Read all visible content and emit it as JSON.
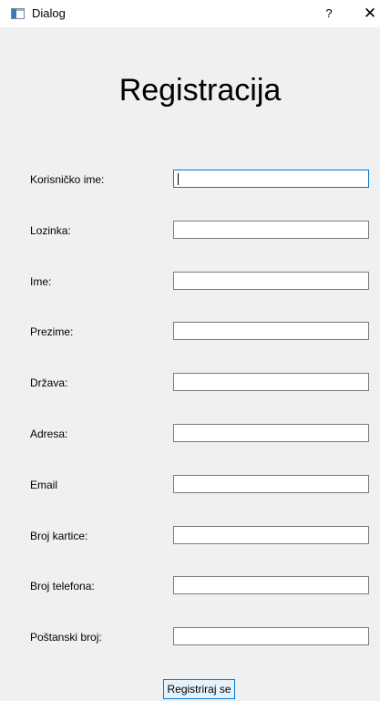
{
  "window": {
    "title": "Dialog",
    "help_glyph": "?",
    "close_glyph": "✕"
  },
  "form": {
    "heading": "Registracija",
    "fields": [
      {
        "label": "Korisničko ime:",
        "value": ""
      },
      {
        "label": "Lozinka:",
        "value": ""
      },
      {
        "label": "Ime:",
        "value": ""
      },
      {
        "label": "Prezime:",
        "value": ""
      },
      {
        "label": "Država:",
        "value": ""
      },
      {
        "label": "Adresa:",
        "value": ""
      },
      {
        "label": "Email",
        "value": ""
      },
      {
        "label": "Broj kartice:",
        "value": ""
      },
      {
        "label": "Broj telefona:",
        "value": ""
      },
      {
        "label": "Poštanski broj:",
        "value": ""
      }
    ],
    "submit_label": "Registriraj se"
  },
  "colors": {
    "background": "#f0f0f0",
    "focus_border": "#0078d7",
    "button_background": "#e5f1fb"
  }
}
